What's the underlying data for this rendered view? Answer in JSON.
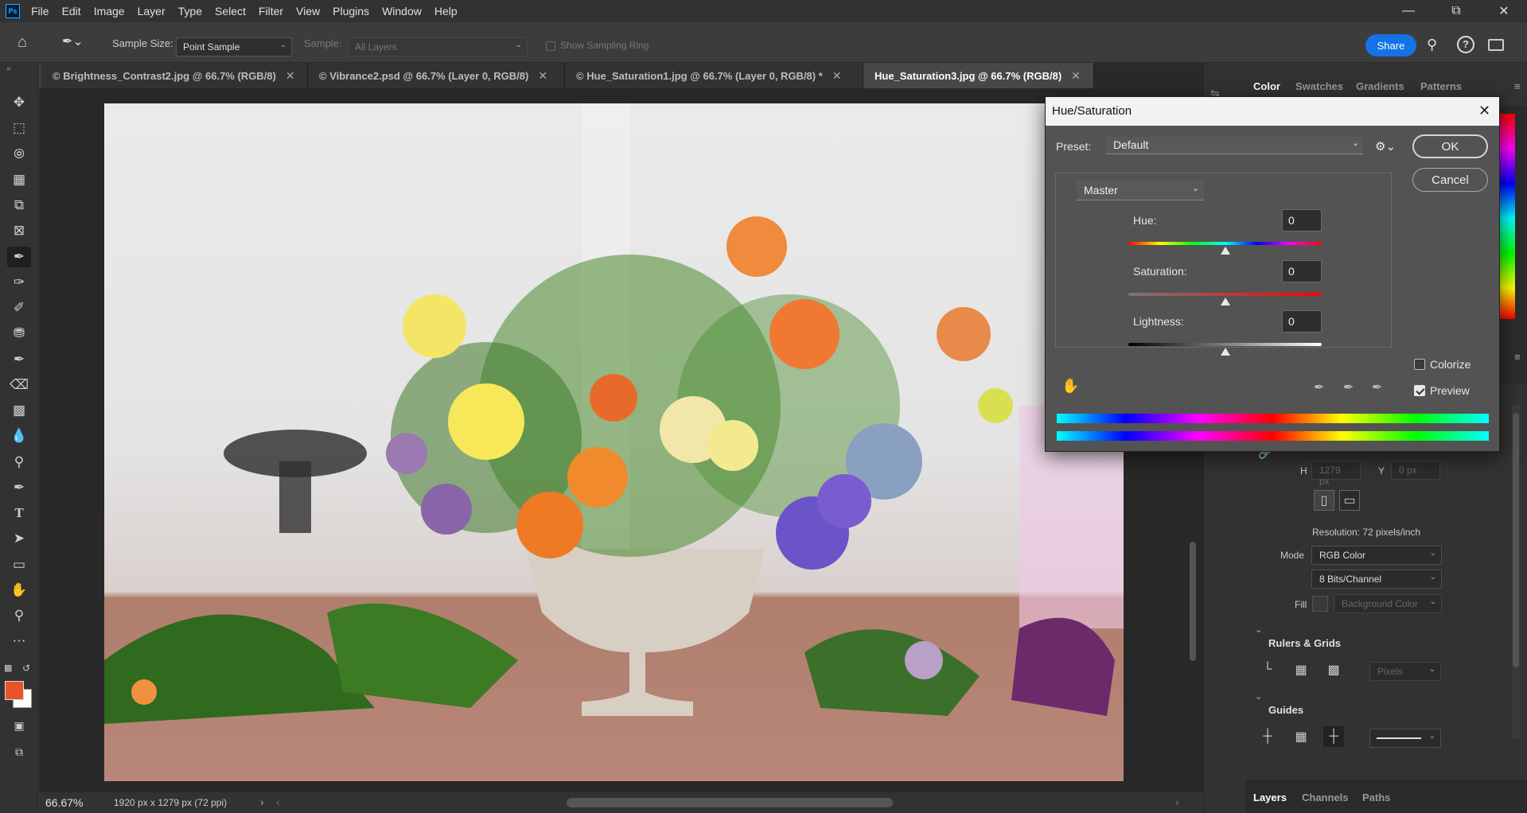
{
  "app": {
    "menu": [
      "File",
      "Edit",
      "Image",
      "Layer",
      "Type",
      "Select",
      "Filter",
      "View",
      "Plugins",
      "Window",
      "Help"
    ],
    "logo": "Ps"
  },
  "options": {
    "sample_size_label": "Sample Size:",
    "sample_size_value": "Point Sample",
    "sample_label": "Sample:",
    "sample_value": "All Layers",
    "show_ring_label": "Show Sampling Ring",
    "share_label": "Share"
  },
  "tabs": [
    {
      "label": "© Brightness_Contrast2.jpg @ 66.7% (RGB/8)"
    },
    {
      "label": "© Vibrance2.psd @ 66.7% (Layer 0, RGB/8)"
    },
    {
      "label": "© Hue_Saturation1.jpg @ 66.7% (Layer 0, RGB/8) *"
    },
    {
      "label": "Hue_Saturation3.jpg @ 66.7% (RGB/8)"
    }
  ],
  "status": {
    "zoom": "66.67%",
    "doc_info": "1920 px x 1279 px (72 ppi)"
  },
  "right_panel": {
    "color_tabs": [
      "Color",
      "Swatches",
      "Gradients",
      "Patterns"
    ],
    "h_label": "H",
    "h_value": "1279 px",
    "y_label": "Y",
    "y_value": "0 px",
    "resolution": "Resolution: 72 pixels/inch",
    "mode_label": "Mode",
    "mode_value": "RGB Color",
    "bits_value": "8 Bits/Channel",
    "fill_label": "Fill",
    "fill_value": "Background Color",
    "rulers_heading": "Rulers & Grids",
    "units_value": "Pixels",
    "guides_heading": "Guides",
    "bottom_tabs": [
      "Layers",
      "Channels",
      "Paths"
    ]
  },
  "dialog": {
    "title": "Hue/Saturation",
    "preset_label": "Preset:",
    "preset_value": "Default",
    "channel_value": "Master",
    "hue_label": "Hue:",
    "hue_value": "0",
    "saturation_label": "Saturation:",
    "saturation_value": "0",
    "lightness_label": "Lightness:",
    "lightness_value": "0",
    "ok_label": "OK",
    "cancel_label": "Cancel",
    "colorize_label": "Colorize",
    "colorize_checked": false,
    "preview_label": "Preview",
    "preview_checked": true
  },
  "colors": {
    "accent": "#1473e6",
    "foreground_swatch": "#e8542a",
    "background_swatch": "#ffffff"
  }
}
